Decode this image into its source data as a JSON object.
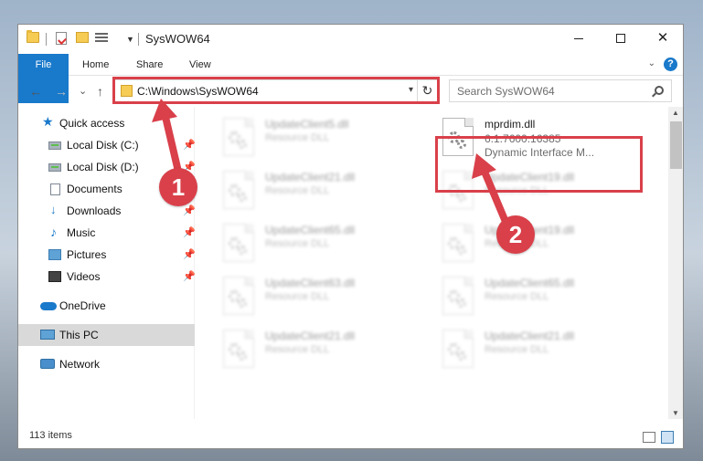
{
  "window": {
    "title": "SysWOW64",
    "controls": {
      "minimize": "",
      "maximize": "",
      "close": "✕"
    }
  },
  "ribbon": {
    "tabs": [
      "File",
      "Home",
      "Share",
      "View"
    ],
    "help": "?"
  },
  "navigation": {
    "back": "←",
    "forward": "→",
    "recent": "⌄",
    "up": "↑",
    "address": "C:\\Windows\\SysWOW64",
    "refresh": "↻",
    "search_placeholder": "Search SysWOW64"
  },
  "sidebar": {
    "items": [
      {
        "label": "Quick access",
        "icon": "star-icon",
        "pinned": false
      },
      {
        "label": "Local Disk (C:)",
        "icon": "disk-icon",
        "pinned": true
      },
      {
        "label": "Local Disk (D:)",
        "icon": "disk-icon",
        "pinned": true
      },
      {
        "label": "Documents",
        "icon": "documents-icon",
        "pinned": true
      },
      {
        "label": "Downloads",
        "icon": "download-icon",
        "pinned": true
      },
      {
        "label": "Music",
        "icon": "music-icon",
        "pinned": true
      },
      {
        "label": "Pictures",
        "icon": "pictures-icon",
        "pinned": true
      },
      {
        "label": "Videos",
        "icon": "videos-icon",
        "pinned": true
      },
      {
        "label": "OneDrive",
        "icon": "cloud-icon",
        "pinned": false
      },
      {
        "label": "This PC",
        "icon": "pc-icon",
        "pinned": false,
        "selected": true
      },
      {
        "label": "Network",
        "icon": "network-icon",
        "pinned": false
      }
    ]
  },
  "files": [
    {
      "name": "UpdateClient5.dll",
      "type": "Resource DLL",
      "blurred": true
    },
    {
      "name": "mprdim.dll",
      "version": "6.1.7600.16385",
      "description": "Dynamic Interface M...",
      "highlighted": true
    },
    {
      "name": "UpdateClient21.dll",
      "type": "Resource DLL",
      "blurred": true
    },
    {
      "name": "UpdateClient19.dll",
      "type": "Resource DLL",
      "blurred": true
    },
    {
      "name": "UpdateClient65.dll",
      "type": "Resource DLL",
      "blurred": true
    },
    {
      "name": "UpdateClient19.dll",
      "type": "Resource DLL",
      "blurred": true
    },
    {
      "name": "UpdateClient63.dll",
      "type": "Resource DLL",
      "blurred": true
    },
    {
      "name": "UpdateClient65.dll",
      "type": "Resource DLL",
      "blurred": true
    },
    {
      "name": "UpdateClient21.dll",
      "type": "Resource DLL",
      "blurred": true
    },
    {
      "name": "UpdateClient21.dll",
      "type": "Resource DLL",
      "blurred": true
    }
  ],
  "status": {
    "item_count": "113 items"
  },
  "annotations": {
    "step1": "1",
    "step2": "2"
  },
  "colors": {
    "accent": "#1979ca",
    "highlight": "#d9404a",
    "selection": "#d9d9d9"
  }
}
